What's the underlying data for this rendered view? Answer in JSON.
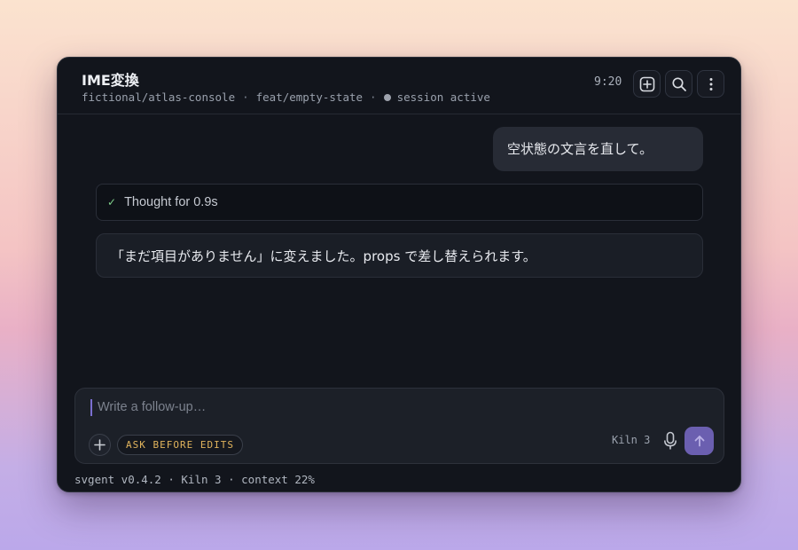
{
  "header": {
    "title": "IME変換",
    "repo": "fictional/atlas-console",
    "branch": "feat/empty-state",
    "session_status": "session active",
    "separator": "·",
    "time": "9:20",
    "buttons": [
      {
        "name": "new-chat",
        "icon": "plus-square-icon"
      },
      {
        "name": "search",
        "icon": "search-icon"
      },
      {
        "name": "more",
        "icon": "vertical-ellipsis-icon"
      }
    ]
  },
  "conversation": {
    "user_message": "空状態の文言を直して。",
    "thought_label": "Thought for 0.9s",
    "thought_icon": "checkmark",
    "assistant_message": "「まだ項目がありません」に変えました。props で差し替えられます。"
  },
  "composer": {
    "placeholder": "Write a follow-up…",
    "mode_badge": "ASK BEFORE EDITS",
    "model": "Kiln 3",
    "attach_icon": "plus-icon",
    "mic_icon": "microphone-icon",
    "send_icon": "arrow-up-icon"
  },
  "footer": {
    "status": "svgent v0.4.2 · Kiln 3 · context 22%"
  },
  "colors": {
    "accent": "#6b5fb0",
    "badge_text": "#e0b35c",
    "check": "#7fd08a",
    "window_bg": "#12151c"
  }
}
